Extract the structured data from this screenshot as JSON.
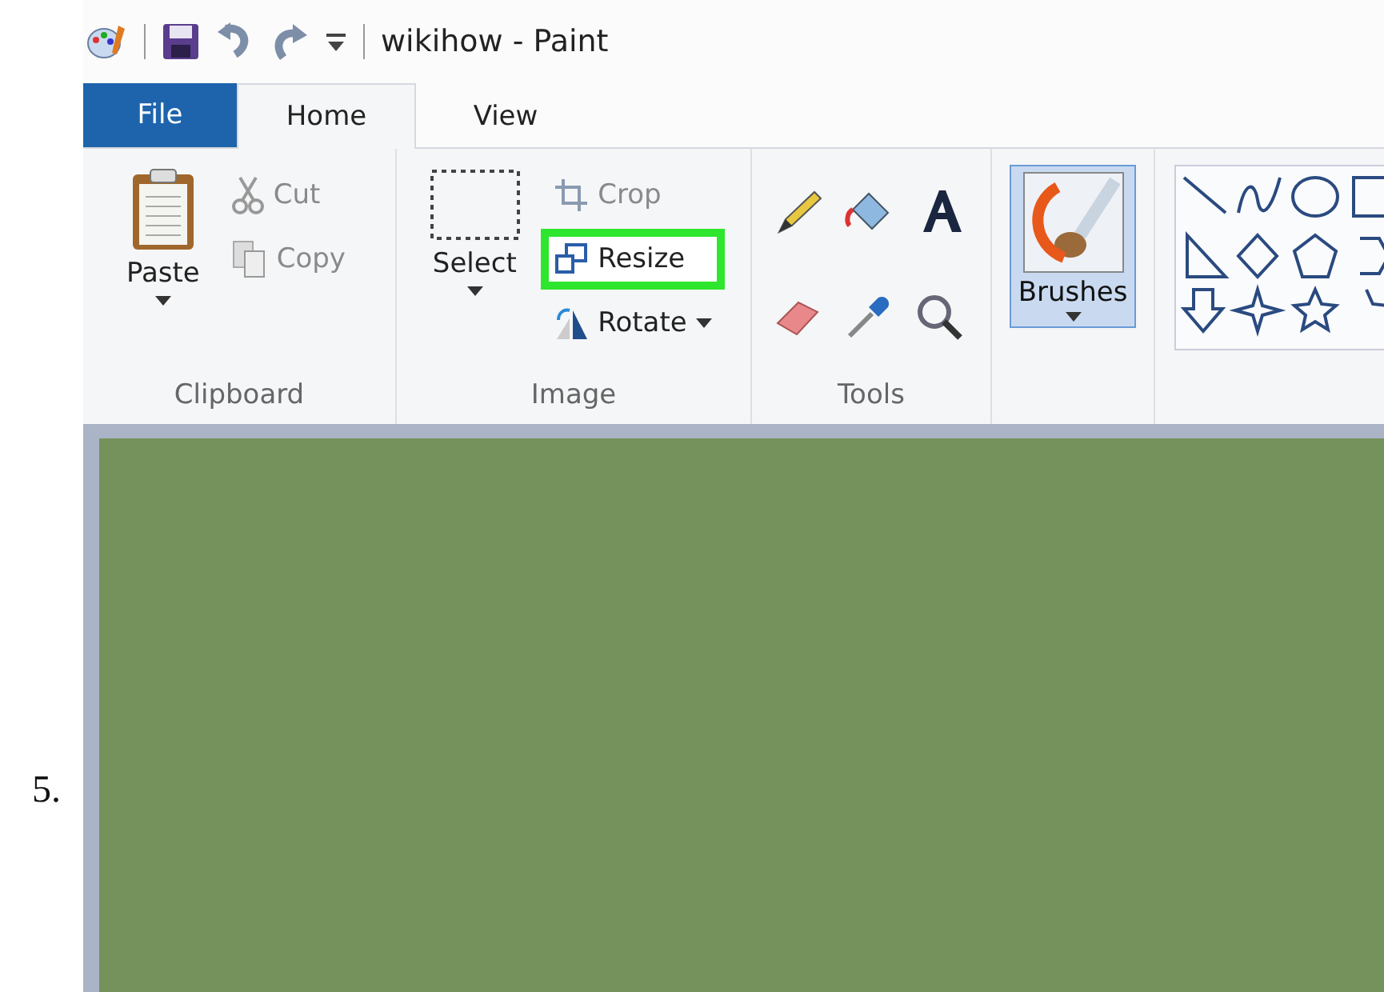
{
  "step_number": "5.",
  "window": {
    "title": "wikihow - Paint"
  },
  "tabs": [
    {
      "label": "File",
      "kind": "file",
      "selected": false
    },
    {
      "label": "Home",
      "kind": "tab",
      "selected": true
    },
    {
      "label": "View",
      "kind": "tab",
      "selected": false
    }
  ],
  "ribbon": {
    "clipboard": {
      "label": "Clipboard",
      "paste": {
        "label": "Paste",
        "disabled": false
      },
      "cut": {
        "label": "Cut",
        "disabled": true
      },
      "copy": {
        "label": "Copy",
        "disabled": true
      }
    },
    "image": {
      "label": "Image",
      "select": {
        "label": "Select"
      },
      "crop": {
        "label": "Crop",
        "disabled": true
      },
      "resize": {
        "label": "Resize",
        "disabled": false,
        "highlighted": true
      },
      "rotate": {
        "label": "Rotate",
        "disabled": false
      }
    },
    "tools": {
      "label": "Tools"
    },
    "brushes": {
      "label": "Brushes",
      "selected": true
    }
  }
}
